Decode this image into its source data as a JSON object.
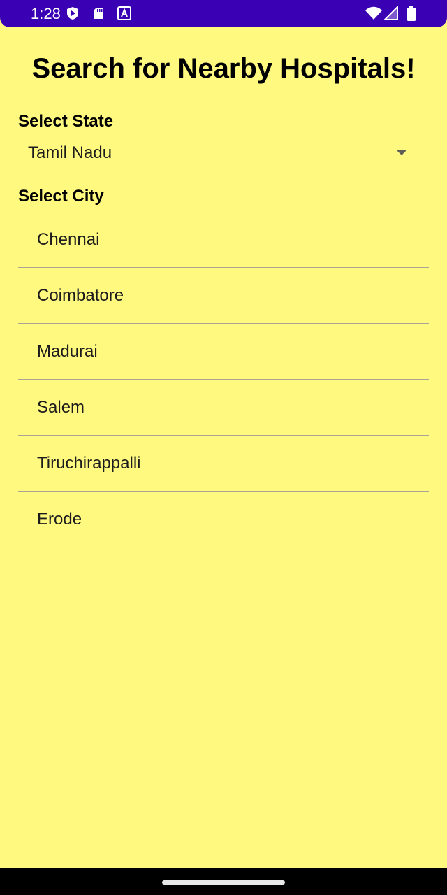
{
  "status_bar": {
    "time": "1:28",
    "background": "#3A00B3",
    "icons": [
      "play-protect-icon",
      "sd-card-icon",
      "text-a-icon",
      "wifi-icon",
      "signal-icon",
      "battery-icon"
    ]
  },
  "page": {
    "background": "#FFF97F",
    "title": "Search for Nearby Hospitals!"
  },
  "state_selector": {
    "label": "Select State",
    "selected_value": "Tamil Nadu",
    "icon": "dropdown-arrow-icon"
  },
  "city_selector": {
    "label": "Select City",
    "cities": [
      "Chennai",
      "Coimbatore",
      "Madurai",
      "Salem",
      "Tiruchirappalli",
      "Erode"
    ]
  },
  "nav_bar": {
    "background": "#000000"
  }
}
